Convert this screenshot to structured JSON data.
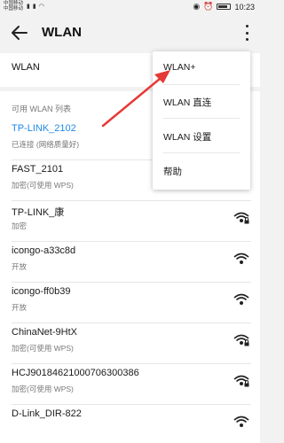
{
  "status_bar": {
    "carrier_1": "中国移动",
    "carrier_2": "中国移动",
    "time": "10:23"
  },
  "header": {
    "title": "WLAN"
  },
  "wlan_toggle": {
    "label": "WLAN"
  },
  "networks": {
    "section_title": "可用 WLAN 列表",
    "items": [
      {
        "name": "TP-LINK_2102",
        "status": "已连接 (网络质量好)",
        "connected": true
      },
      {
        "name": "FAST_2101",
        "status": "加密(可使用 WPS)",
        "locked": true
      },
      {
        "name": "TP-LINK_康",
        "status": "加密",
        "locked": true
      },
      {
        "name": "icongo-a33c8d",
        "status": "开放",
        "locked": false
      },
      {
        "name": "icongo-ff0b39",
        "status": "开放",
        "locked": false
      },
      {
        "name": "ChinaNet-9HtX",
        "status": "加密(可使用 WPS)",
        "locked": true
      },
      {
        "name": "HCJ90184621000706300386",
        "status": "加密(可使用 WPS)",
        "locked": true
      },
      {
        "name": "D-Link_DIR-822",
        "status": "",
        "locked": false
      }
    ]
  },
  "menu": {
    "items": [
      {
        "label": "WLAN+"
      },
      {
        "label": "WLAN 直连"
      },
      {
        "label": "WLAN 设置"
      },
      {
        "label": "帮助"
      }
    ]
  },
  "colors": {
    "accent": "#1e88e5",
    "annotation_arrow": "#e53935"
  }
}
